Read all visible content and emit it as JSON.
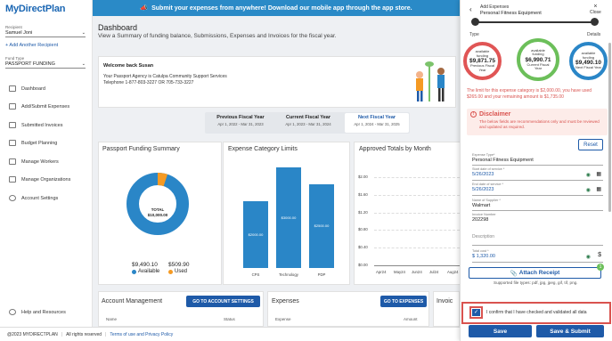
{
  "app": {
    "logo_a": "My",
    "logo_b": "DirectPlan"
  },
  "sidebar": {
    "recipient_label": "Recipient",
    "recipient_value": "Samuel Joni",
    "add_recipient": "+ Add Another Recipient",
    "fund_type_label": "Fund Type",
    "fund_type_value": "PASSPORT FUNDING",
    "items": [
      {
        "label": "Dashboard"
      },
      {
        "label": "Add/Submit Expenses"
      },
      {
        "label": "Submitted Invoices"
      },
      {
        "label": "Budget Planning"
      },
      {
        "label": "Manage Workers"
      },
      {
        "label": "Manage Organizations"
      },
      {
        "label": "Account Settings"
      }
    ],
    "help": "Help and Resources"
  },
  "banner": {
    "text": "Submit your expenses from anywhere! Download our mobile app through the app store."
  },
  "dashboard": {
    "title": "Dashboard",
    "subtitle": "View a Summary of funding balance, Submissions, Expenses and Invoices for the fiscal year.",
    "welcome": "Welcome back Susan",
    "agency_line": "Your Passport Agency is Catulpa Community Support Services",
    "phone_line": "Telephone 1-877-803-3227 OR 705-733-3227"
  },
  "fiscal": {
    "tabs": [
      {
        "label": "Previous Fiscal Year",
        "dates": "Apr 1, 2022 - Mar 31, 2023"
      },
      {
        "label": "Current Fiscal Year",
        "dates": "Apr 1, 2023 - Mar 31, 2024"
      },
      {
        "label": "Next Fiscal Year",
        "dates": "Apr 1, 2024 - Mar 31, 2025"
      }
    ]
  },
  "funding_summary": {
    "title": "Passport Funding Summary",
    "center_label": "TOTAL",
    "center_value": "$10,000.00",
    "available_value": "$9,490.10",
    "available_label": "Available",
    "used_value": "$509.90",
    "used_label": "Used",
    "available_color": "#2a86c7",
    "used_color": "#f59a23"
  },
  "expense_limits": {
    "title": "Expense Category Limits",
    "chart_data": {
      "type": "bar",
      "categories": [
        "CPS",
        "Technology",
        "PDP"
      ],
      "values": [
        2000,
        3000,
        2500
      ],
      "value_labels": [
        "$2000.00",
        "$3000.00",
        "$2500.00"
      ]
    }
  },
  "approved": {
    "title": "Approved Totals by Month",
    "chart_data": {
      "type": "bar",
      "categories": [
        "Apr24",
        "May24",
        "Jun24",
        "Jul24",
        "Aug24"
      ],
      "yticks": [
        "$2.00",
        "$1.60",
        "$1.20",
        "$0.80",
        "$0.40",
        "$0.00"
      ],
      "values": [
        0,
        0,
        0,
        0,
        0
      ]
    }
  },
  "account": {
    "title": "Account Management",
    "button": "GO TO ACCOUNT SETTINGS",
    "col1": "Name",
    "col2": "Status"
  },
  "expenses": {
    "title": "Expenses",
    "button": "GO TO EXPENSES",
    "col1": "Expense",
    "col2": "Amount"
  },
  "invoices": {
    "title": "Invoic"
  },
  "footer": {
    "copyright": "@2023 MYDIRECTPLAN",
    "rights": "All rights reserved",
    "link": "Terms of use and Privacy Policy"
  },
  "panel": {
    "heading": "Add Expenses",
    "subheading": "Personal Fitness Equipment",
    "close": "Close",
    "step1": "Type",
    "step2": "Details",
    "rings": [
      {
        "t1": "available",
        "t2": "funding",
        "value": "$9,871.75",
        "t3": "Previous Fiscal",
        "t4": "Year",
        "color": "#e05555"
      },
      {
        "t1": "available",
        "t2": "funding",
        "value": "$6,990.71",
        "t3": "Current Fiscal",
        "t4": "Year",
        "color": "#6cbf5a"
      },
      {
        "t1": "available",
        "t2": "funding",
        "value": "$9,490.10",
        "t3": "Next Fiscal Year",
        "t4": "",
        "color": "#2a86c7"
      }
    ],
    "limit_text": "The limit for this expense category is $2,000.00, you have used $265.00 and your remaining amount is $1,735.00",
    "disclaimer_title": "Disclaimer",
    "disclaimer_text": "The below fields are recommendations only and must be reviewed and updated as required.",
    "reset": "Reset",
    "fields": [
      {
        "label": "Expense Type*",
        "value": "Personal Fitness Equipment"
      },
      {
        "label": "Start date of service *",
        "value": "5/26/2023"
      },
      {
        "label": "End date of service *",
        "value": "5/26/2023"
      },
      {
        "label": "Name of Supplier *",
        "value": "Walmart"
      },
      {
        "label": "Invoice Number",
        "value": "202298"
      }
    ],
    "description_placeholder": "Description",
    "total_label": "Total cost *",
    "total_value": "$ 1,320.00",
    "attach": "Attach Receipt",
    "attach_badge": "1",
    "filetypes": "Supported file types: pdf, jpg, jpeg, gif, tif, png.",
    "confirm": "I confirm that I have checked and validated all data",
    "save": "Save",
    "save_submit": "Save & Submit"
  },
  "colors": {
    "primary": "#1e5aa8",
    "accent": "#2a86c7",
    "highlight": "#d9534f"
  }
}
